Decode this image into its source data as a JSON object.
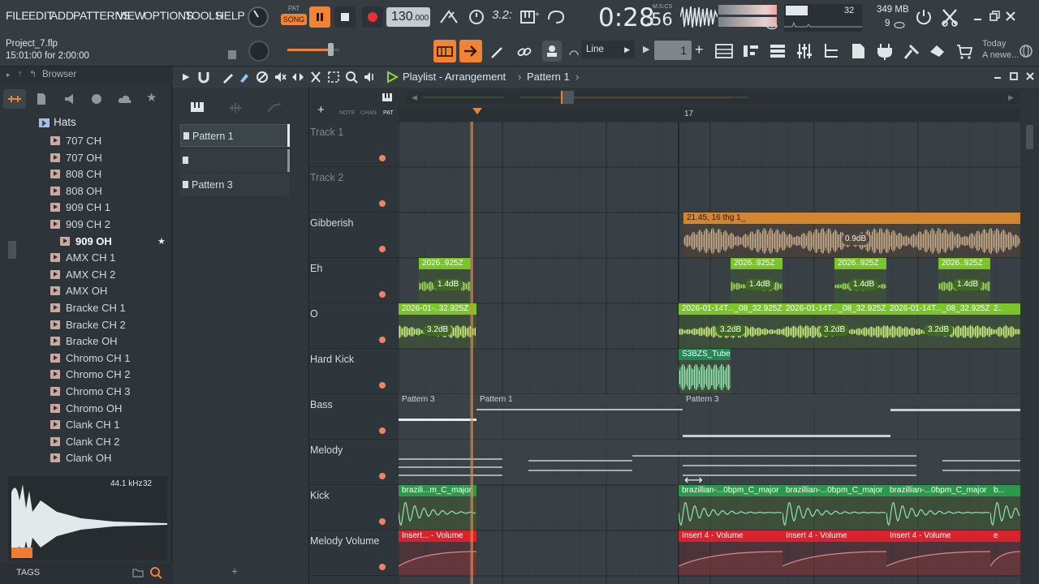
{
  "menu": [
    "FILE",
    "EDIT",
    "ADD",
    "PATTERNS",
    "VIEW",
    "OPTIONS",
    "TOOLS",
    "HELP"
  ],
  "transport": {
    "pat_label": "PAT",
    "song_label": "SONG",
    "tempo": "130",
    "tempo_dec": ".000",
    "time": "0:28",
    "time_small": ":56",
    "time_unit": "M:S:CS"
  },
  "hint": {
    "project": "Project_7.flp",
    "info": "15:01:00 for 2:00:00"
  },
  "cpu": {
    "voices": "32",
    "memory": "349 MB",
    "polyphony": "9"
  },
  "snap": {
    "mode": "Line",
    "step": "1"
  },
  "news": {
    "line1": "Today",
    "line2": "A newe..."
  },
  "browser": {
    "title": "Browser",
    "folder": "Hats",
    "items": [
      "707 CH",
      "707 OH",
      "808 CH",
      "808 OH",
      "909 CH 1",
      "909 CH 2",
      "909 OH",
      "AMX CH 1",
      "AMX CH 2",
      "AMX OH",
      "Bracke CH 1",
      "Bracke CH 2",
      "Bracke OH",
      "Chromo CH 1",
      "Chromo CH 2",
      "Chromo CH 3",
      "Chromo OH",
      "Clank CH 1",
      "Clank CH 2",
      "Clank OH"
    ],
    "selected": "909 OH",
    "sample_rate": "44.1 kHz",
    "bits": "32",
    "tags": "TAGS"
  },
  "playlist": {
    "title": "Playlist - Arrangement",
    "pattern": "Pattern 1",
    "bar_marker": "17",
    "tab_note": "NOTE",
    "tab_chan": "CHAN",
    "tab_pat": "PAT"
  },
  "picker": {
    "patterns": [
      "Pattern 1",
      "",
      "Pattern 3"
    ]
  },
  "tracks": [
    "Track 1",
    "Track 2",
    "Gibberish",
    "Eh",
    "O",
    "Hard Kick",
    "Bass",
    "Melody",
    "Kick",
    "Melody Volume"
  ],
  "clips": {
    "gib_name": "21.45, 16 thg 1_",
    "gib_db": "0.9dB",
    "eh_name": "2026..925Z",
    "eh_db": "1.4dB",
    "o_name1": "2026-01-..32.925Z",
    "o_name2": "2026-01-14T..._08_32.925Z",
    "o_name_short": "2..",
    "o_db": "3.2dB",
    "kick_hard": "S3BZS_Tube",
    "bass_p3": "Pattern 3",
    "bass_p1": "Pattern 1",
    "kick1": "brazili...m_C_major",
    "kick2": "brazillian-...0bpm_C_major",
    "kick_short": "b...",
    "vol1": "Insert... - Volume",
    "vol2": "Insert 4 - Volume",
    "vol_short": "e"
  },
  "colors": {
    "accent": "#f08434",
    "audio_green": "#79c52a",
    "automation_red": "#d8232f",
    "playhead": "#f08434"
  }
}
